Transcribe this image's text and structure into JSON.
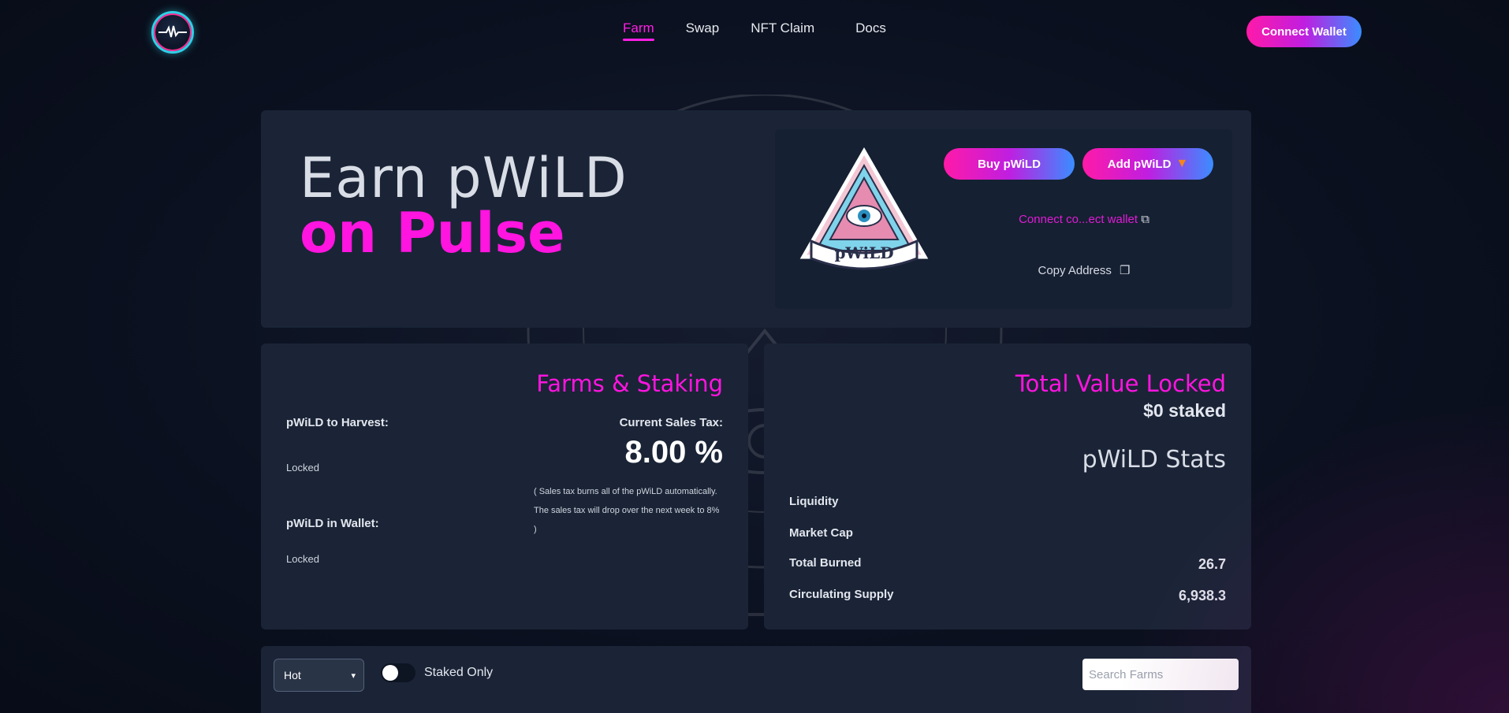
{
  "nav": {
    "items": [
      "Farm",
      "Swap",
      "NFT Claim",
      "Docs"
    ],
    "connect_wallet": "Connect Wallet"
  },
  "hero": {
    "title_line1": "Earn pWiLD",
    "title_line2": "on Pulse",
    "buy_label": "Buy pWiLD",
    "add_label": "Add pWiLD",
    "contract_link": "Connect co...ect wallet",
    "copy_address": "Copy Address",
    "token_logo_text": "pWiLD"
  },
  "farms": {
    "title": "Farms & Staking",
    "harvest_label": "pWiLD to Harvest:",
    "harvest_value": "Locked",
    "wallet_label": "pWiLD in Wallet:",
    "wallet_value": "Locked",
    "sales_tax_label": "Current Sales Tax:",
    "sales_tax_value": "8.00 %",
    "tax_note_1": "( Sales tax burns all of the pWiLD automatically.",
    "tax_note_2": "The sales tax will drop over the next week to 8% )"
  },
  "tvl": {
    "title": "Total Value Locked",
    "staked": "$0 staked",
    "stats_title": "pWiLD Stats",
    "rows": [
      {
        "label": "Liquidity",
        "value": ""
      },
      {
        "label": "Market Cap",
        "value": ""
      },
      {
        "label": "Total Burned",
        "value": "26.7"
      },
      {
        "label": "Circulating Supply",
        "value": "6,938.3"
      }
    ]
  },
  "filter": {
    "sort_selected": "Hot",
    "staked_only": "Staked Only",
    "search_placeholder": "Search Farms"
  },
  "colors": {
    "accent": "#ff14e0",
    "panel": "#1a2436",
    "background": "#0b1120"
  }
}
